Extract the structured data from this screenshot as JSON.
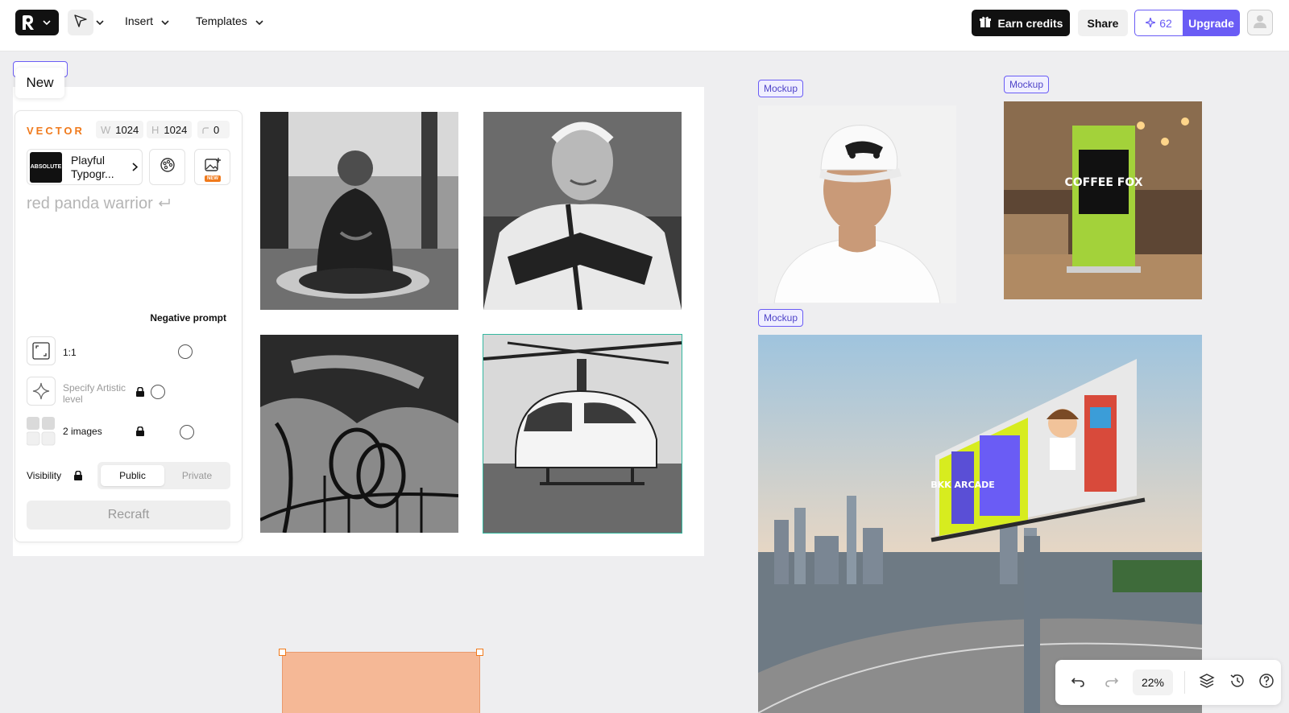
{
  "header": {
    "insert_label": "Insert",
    "templates_label": "Templates",
    "earn_credits_label": "Earn credits",
    "share_label": "Share",
    "credits_count": "62",
    "upgrade_label": "Upgrade"
  },
  "frame": {
    "tooltip": "New"
  },
  "panel": {
    "mode": "VECTOR",
    "width_key": "W",
    "width": "1024",
    "height_key": "H",
    "height": "1024",
    "corner_value": "0",
    "style_thumb_text": "ABSOLUTE",
    "style_name": "Playful Typogr...",
    "new_badge": "NEW",
    "prompt_placeholder": "red panda warrior",
    "negative_prompt_label": "Negative prompt",
    "aspect_ratio": "1:1",
    "artistic_level": "Specify Artistic level",
    "images_count": "2 images",
    "visibility_label": "Visibility",
    "visibility_options": [
      "Public",
      "Private"
    ],
    "recraft_label": "Recraft"
  },
  "mockups": {
    "tag_label": "Mockup",
    "standee_text": "COFFEE FOX",
    "billboard_text": "BKK ARCADE"
  },
  "bottombar": {
    "zoom": "22%"
  },
  "colors": {
    "accent": "#6a5cf5",
    "vector_orange": "#f07a1c",
    "selection_teal": "#35b8a0"
  }
}
